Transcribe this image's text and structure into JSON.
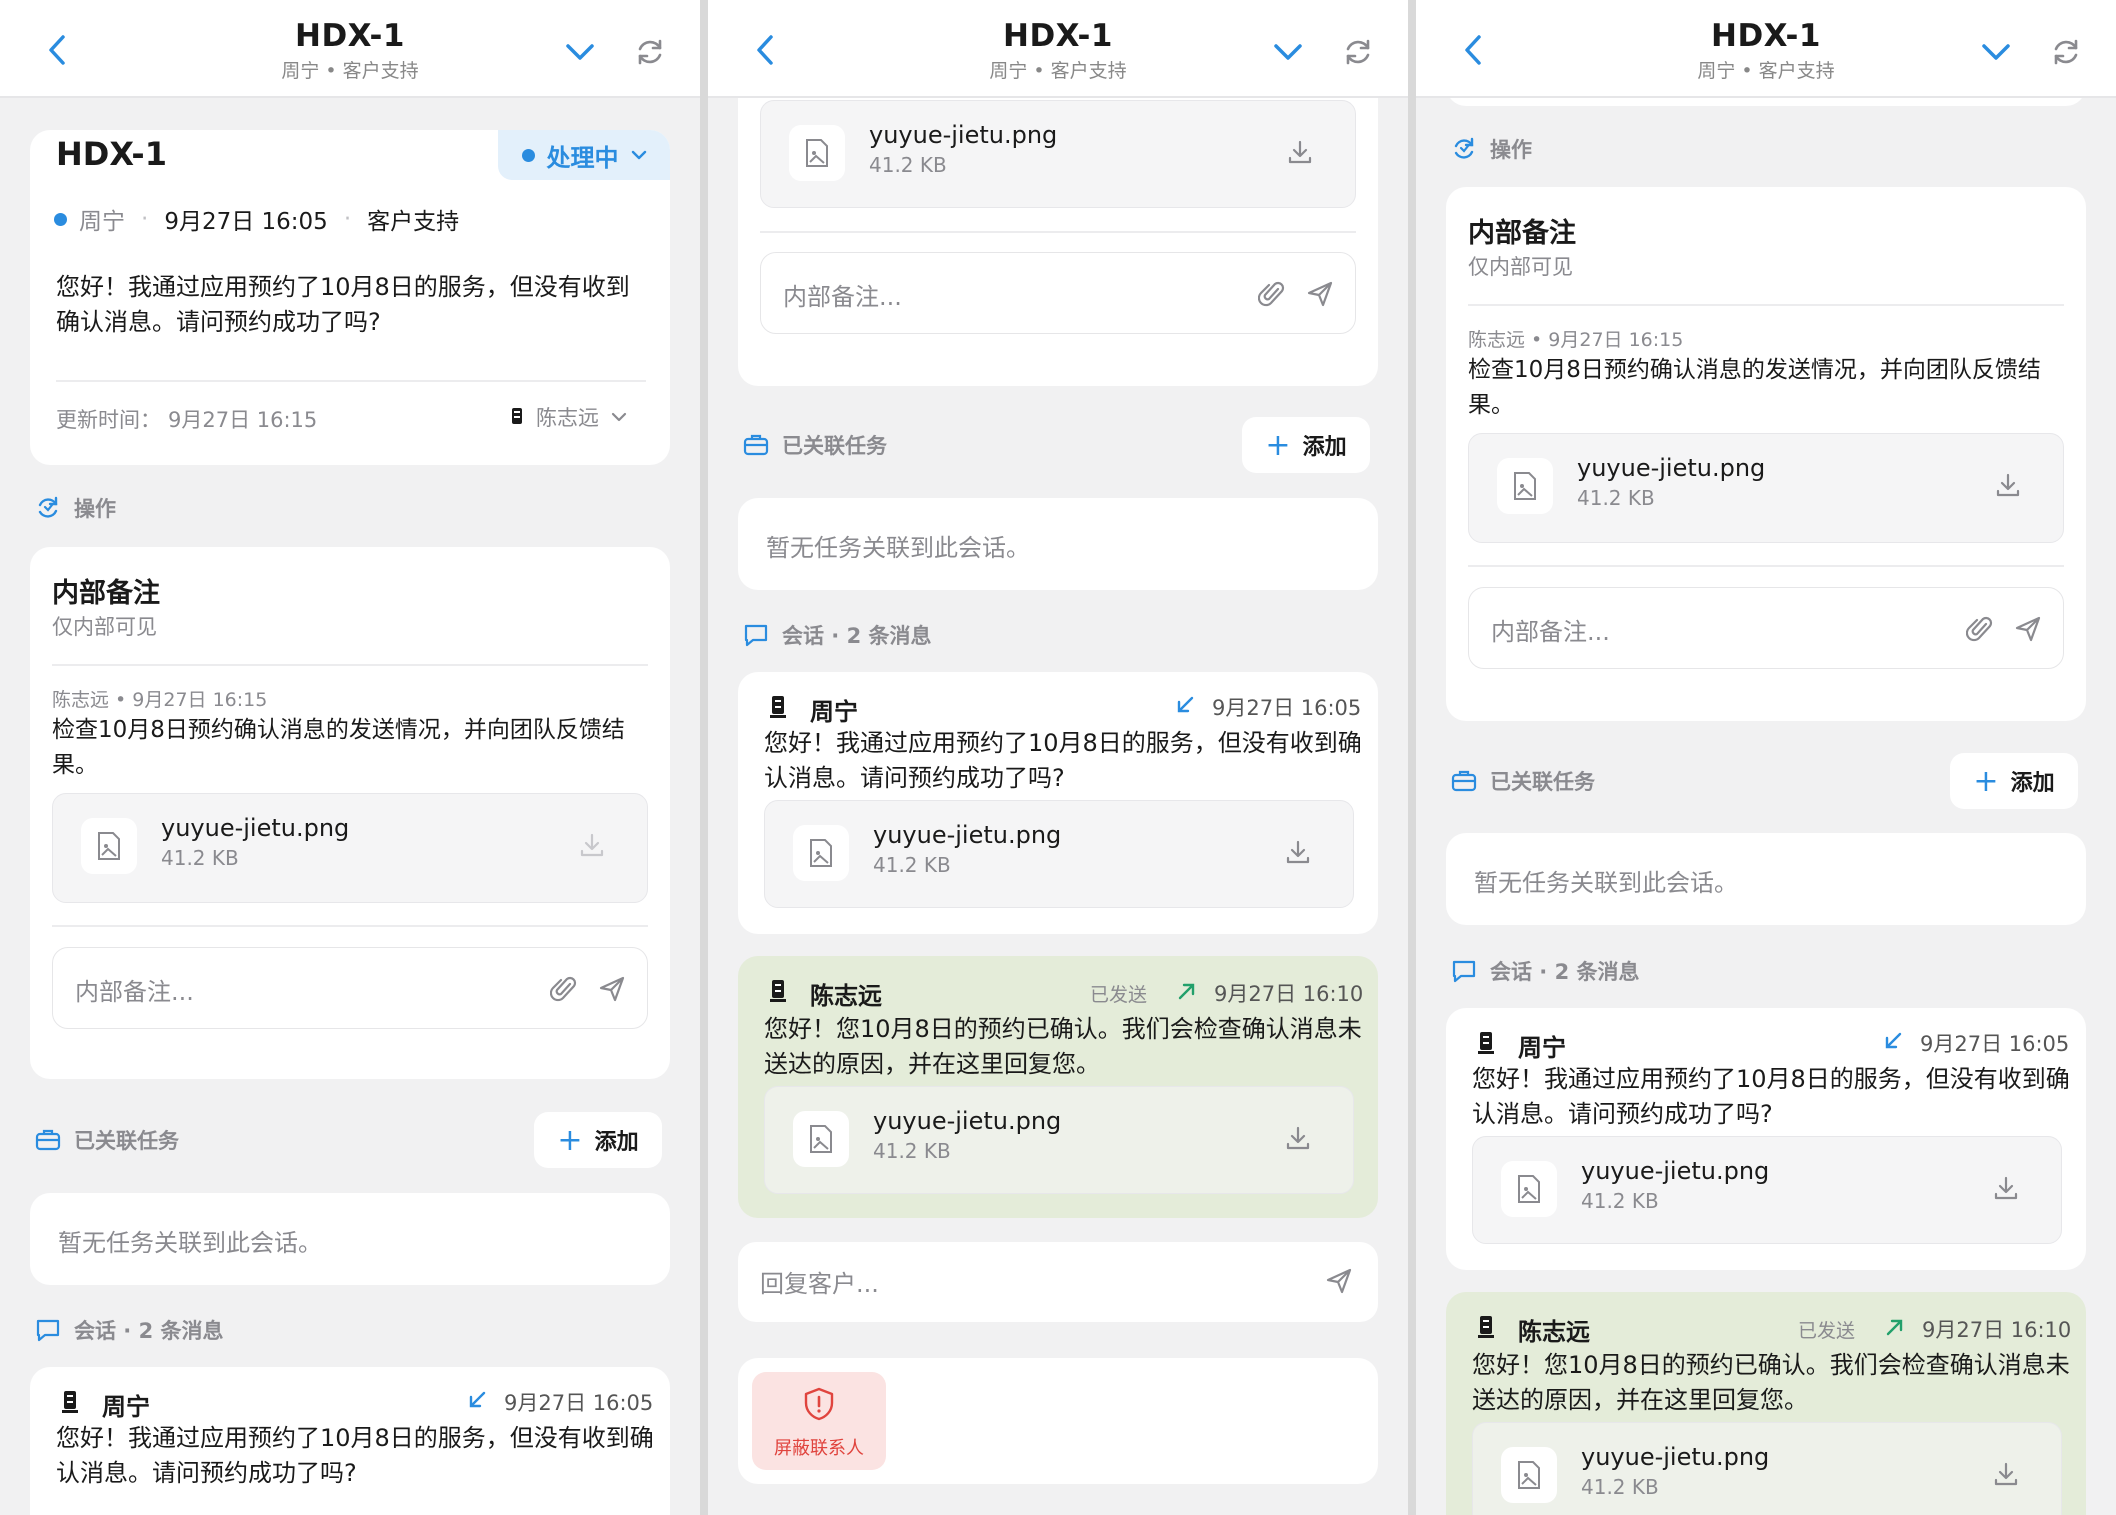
{
  "header": {
    "title": "HDX-1",
    "subtitle": "周宁 • 客户支持"
  },
  "ticket": {
    "id": "HDX-1",
    "status": "处理中",
    "customer": "周宁",
    "created": "9月27日 16:05",
    "channel": "客户支持",
    "message": "您好！我通过应用预约了10月8日的服务，但没有收到确认消息。请问预约成功了吗?",
    "updated_label": "更新时间：",
    "updated": "9月27日 16:15",
    "assignee": "陈志远"
  },
  "sections": {
    "actions": "操作",
    "tasks": "已关联任务",
    "conversation": "会话 · 2 条消息"
  },
  "note": {
    "title": "内部备注",
    "subtitle": "仅内部可见",
    "meta": "陈志远 • 9月27日 16:15",
    "text": "检查10月8日预约确认消息的发送情况，并向团队反馈结果。",
    "placeholder": "内部备注..."
  },
  "file": {
    "name": "yuyue-jietu.png",
    "size": "41.2 KB"
  },
  "tasks": {
    "add_label": "添加",
    "empty": "暂无任务关联到此会话。"
  },
  "messages": [
    {
      "sender": "周宁",
      "time": "9月27日 16:05",
      "text": "您好！我通过应用预约了10月8日的服务，但没有收到确认消息。请问预约成功了吗?"
    },
    {
      "sender": "陈志远",
      "status": "已发送",
      "time": "9月27日 16:10",
      "text": "您好！您10月8日的预约已确认。我们会检查确认消息未送达的原因，并在这里回复您。"
    }
  ],
  "reply": {
    "placeholder": "回复客户..."
  },
  "block": {
    "label": "屏蔽联系人"
  },
  "colors": {
    "accent": "#2a8cdf",
    "outgoing_bg": "#e4ecd9",
    "danger": "#e0443e",
    "danger_bg": "#fbe3e2"
  }
}
